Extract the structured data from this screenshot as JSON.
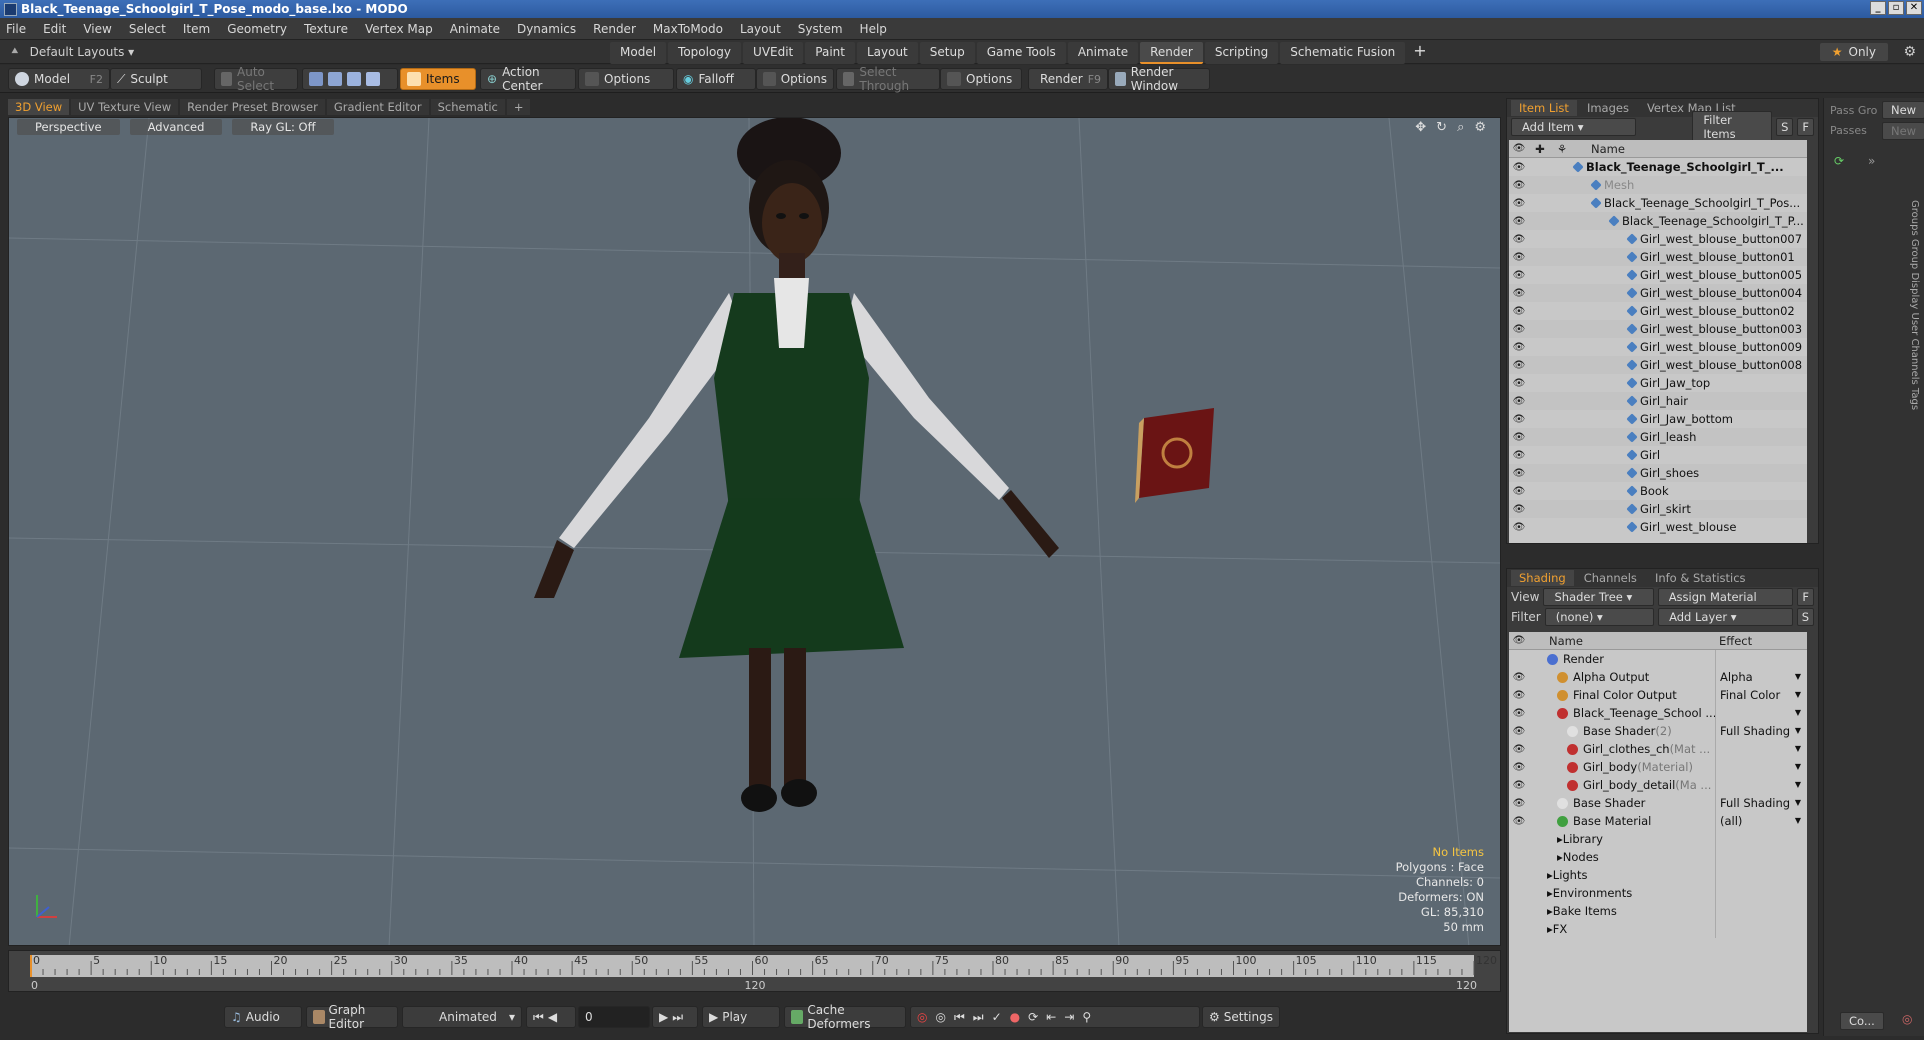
{
  "window": {
    "title": "Black_Teenage_Schoolgirl_T_Pose_modo_base.lxo - MODO"
  },
  "menu": [
    "File",
    "Edit",
    "View",
    "Select",
    "Item",
    "Geometry",
    "Texture",
    "Vertex Map",
    "Animate",
    "Dynamics",
    "Render",
    "MaxToModo",
    "Layout",
    "System",
    "Help"
  ],
  "layout": {
    "dropdown": "Default Layouts",
    "tabs": [
      "Model",
      "Topology",
      "UVEdit",
      "Paint",
      "Layout",
      "Setup",
      "Game Tools",
      "Animate",
      "Render",
      "Scripting",
      "Schematic Fusion"
    ],
    "active_tab": "Render",
    "only": "Only"
  },
  "toolbar": {
    "model": "Model",
    "model_key": "F2",
    "sculpt": "Sculpt",
    "auto_select": "Auto Select",
    "items": "Items",
    "action_center": "Action Center",
    "options1": "Options",
    "falloff": "Falloff",
    "options2": "Options",
    "select_through": "Select Through",
    "options3": "Options",
    "render": "Render",
    "render_key": "F9",
    "render_window": "Render Window"
  },
  "viewport_tabs": [
    "3D View",
    "UV Texture View",
    "Render Preset Browser",
    "Gradient Editor",
    "Schematic"
  ],
  "viewport": {
    "view_mode": "Perspective",
    "shading": "Advanced",
    "raygl": "Ray GL: Off"
  },
  "stats": {
    "items": "No Items",
    "polygons": "Polygons : Face",
    "channels": "Channels: 0",
    "deformers": "Deformers: ON",
    "gl": "GL: 85,310",
    "lens": "50 mm"
  },
  "timeline": {
    "ticks": [
      "0",
      "5",
      "10",
      "15",
      "20",
      "25",
      "30",
      "35",
      "40",
      "45",
      "50",
      "55",
      "60",
      "65",
      "70",
      "75",
      "80",
      "85",
      "90",
      "95",
      "100",
      "105",
      "110",
      "115",
      "120"
    ],
    "start": "0",
    "mid": "120",
    "end": "120"
  },
  "bottom": {
    "audio": "Audio",
    "graph_editor": "Graph Editor",
    "animated": "Animated",
    "frame": "0",
    "play": "Play",
    "cache": "Cache Deformers",
    "settings": "Settings"
  },
  "item_panel": {
    "tabs": [
      "Item List",
      "Images",
      "Vertex Map List"
    ],
    "add_item": "Add Item",
    "filter_items": "Filter Items",
    "s": "S",
    "f": "F",
    "name_header": "Name",
    "rows": [
      {
        "name": "Black_Teenage_Schoolgirl_T_...",
        "indent": 0,
        "bold": true
      },
      {
        "name": "Mesh",
        "indent": 1,
        "dim": true
      },
      {
        "name": "Black_Teenage_Schoolgirl_T_Pos...",
        "indent": 1
      },
      {
        "name": "Black_Teenage_Schoolgirl_T_P...",
        "indent": 2
      },
      {
        "name": "Girl_west_blouse_button007",
        "indent": 3
      },
      {
        "name": "Girl_west_blouse_button01",
        "indent": 3
      },
      {
        "name": "Girl_west_blouse_button005",
        "indent": 3
      },
      {
        "name": "Girl_west_blouse_button004",
        "indent": 3
      },
      {
        "name": "Girl_west_blouse_button02",
        "indent": 3
      },
      {
        "name": "Girl_west_blouse_button003",
        "indent": 3
      },
      {
        "name": "Girl_west_blouse_button009",
        "indent": 3
      },
      {
        "name": "Girl_west_blouse_button008",
        "indent": 3
      },
      {
        "name": "Girl_Jaw_top",
        "indent": 3
      },
      {
        "name": "Girl_hair",
        "indent": 3
      },
      {
        "name": "Girl_Jaw_bottom",
        "indent": 3
      },
      {
        "name": "Girl_leash",
        "indent": 3
      },
      {
        "name": "Girl",
        "indent": 3
      },
      {
        "name": "Girl_shoes",
        "indent": 3
      },
      {
        "name": "Book",
        "indent": 3
      },
      {
        "name": "Girl_skirt",
        "indent": 3
      },
      {
        "name": "Girl_west_blouse",
        "indent": 3
      }
    ]
  },
  "shading_panel": {
    "tabs": [
      "Shading",
      "Channels",
      "Info & Statistics"
    ],
    "view_label": "View",
    "view_value": "Shader Tree",
    "assign": "Assign Material",
    "f": "F",
    "filter_label": "Filter",
    "filter_value": "(none)",
    "add_layer": "Add Layer",
    "s": "S",
    "name_header": "Name",
    "effect_header": "Effect",
    "rows": [
      {
        "name": "Render",
        "effect": "",
        "indent": 0,
        "color": "#4a6fd0",
        "eye": false
      },
      {
        "name": "Alpha Output",
        "effect": "Alpha",
        "indent": 1,
        "color": "#d09030",
        "eye": true
      },
      {
        "name": "Final Color Output",
        "effect": "Final Color",
        "indent": 1,
        "color": "#d09030",
        "eye": true
      },
      {
        "name": "Black_Teenage_School ...",
        "effect": "",
        "indent": 1,
        "color": "#c03030",
        "eye": true
      },
      {
        "name": "Base Shader",
        "suffix": "(2)",
        "effect": "Full Shading",
        "indent": 2,
        "color": "#e0e0e0",
        "eye": true
      },
      {
        "name": "Girl_clothes_ch",
        "suffix": "(Mat ...",
        "effect": "",
        "indent": 2,
        "color": "#c03030",
        "eye": true
      },
      {
        "name": "Girl_body",
        "suffix": "(Material)",
        "effect": "",
        "indent": 2,
        "color": "#c03030",
        "eye": true
      },
      {
        "name": "Girl_body_detail",
        "suffix": "(Ma ...",
        "effect": "",
        "indent": 2,
        "color": "#c03030",
        "eye": true
      },
      {
        "name": "Base Shader",
        "effect": "Full Shading",
        "indent": 1,
        "color": "#e0e0e0",
        "eye": true
      },
      {
        "name": "Base Material",
        "effect": "(all)",
        "indent": 1,
        "color": "#40a040",
        "eye": true
      },
      {
        "name": "Library",
        "effect": "",
        "indent": 1,
        "color": "",
        "eye": false
      },
      {
        "name": "Nodes",
        "effect": "",
        "indent": 1,
        "color": "",
        "eye": false
      },
      {
        "name": "Lights",
        "effect": "",
        "indent": 0,
        "color": "",
        "eye": false
      },
      {
        "name": "Environments",
        "effect": "",
        "indent": 0,
        "color": "",
        "eye": false
      },
      {
        "name": "Bake Items",
        "effect": "",
        "indent": 0,
        "color": "",
        "eye": false
      },
      {
        "name": "FX",
        "effect": "",
        "indent": 0,
        "color": "",
        "eye": false
      }
    ]
  },
  "far_panel": {
    "pass_group": "Pass Gro",
    "passes": "Passes",
    "new1": "New",
    "new2": "New",
    "vtabs": "Groups   Group Display   User Channels   Tags",
    "co": "Co..."
  }
}
